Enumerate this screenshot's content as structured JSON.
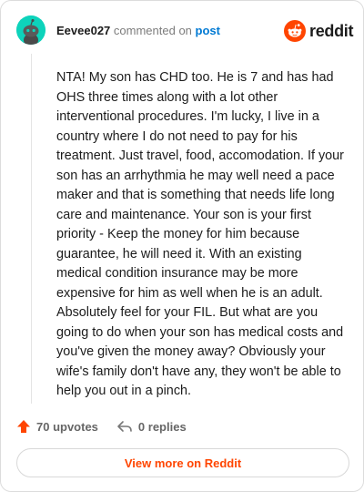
{
  "header": {
    "username": "Eevee027",
    "commented_on": "commented on",
    "post_link": "post",
    "brand": "reddit"
  },
  "comment": {
    "text": "NTA! My son has CHD too. He is 7 and has had OHS three times along with a lot other interventional procedures. I'm lucky, I live in a country where I do not need to pay for his treatment. Just travel, food, accomodation. If your son has an arrhythmia he may well need a pace maker and that is something that needs life long care and maintenance. Your son is your first priority - Keep the money for him because guarantee, he will need it. With an existing medical condition insurance may be more expensive for him as well when he is an adult. Absolutely feel for your FIL. But what are you going to do when your son has medical costs and you've given the money away? Obviously your wife's family don't have any, they won't be able to help you out in a pinch."
  },
  "actions": {
    "upvotes": "70 upvotes",
    "replies": "0 replies"
  },
  "footer": {
    "view_more": "View more on Reddit"
  },
  "colors": {
    "brand_orange": "#ff4500",
    "link_blue": "#0079d3",
    "avatar_teal": "#0dd3bb"
  }
}
